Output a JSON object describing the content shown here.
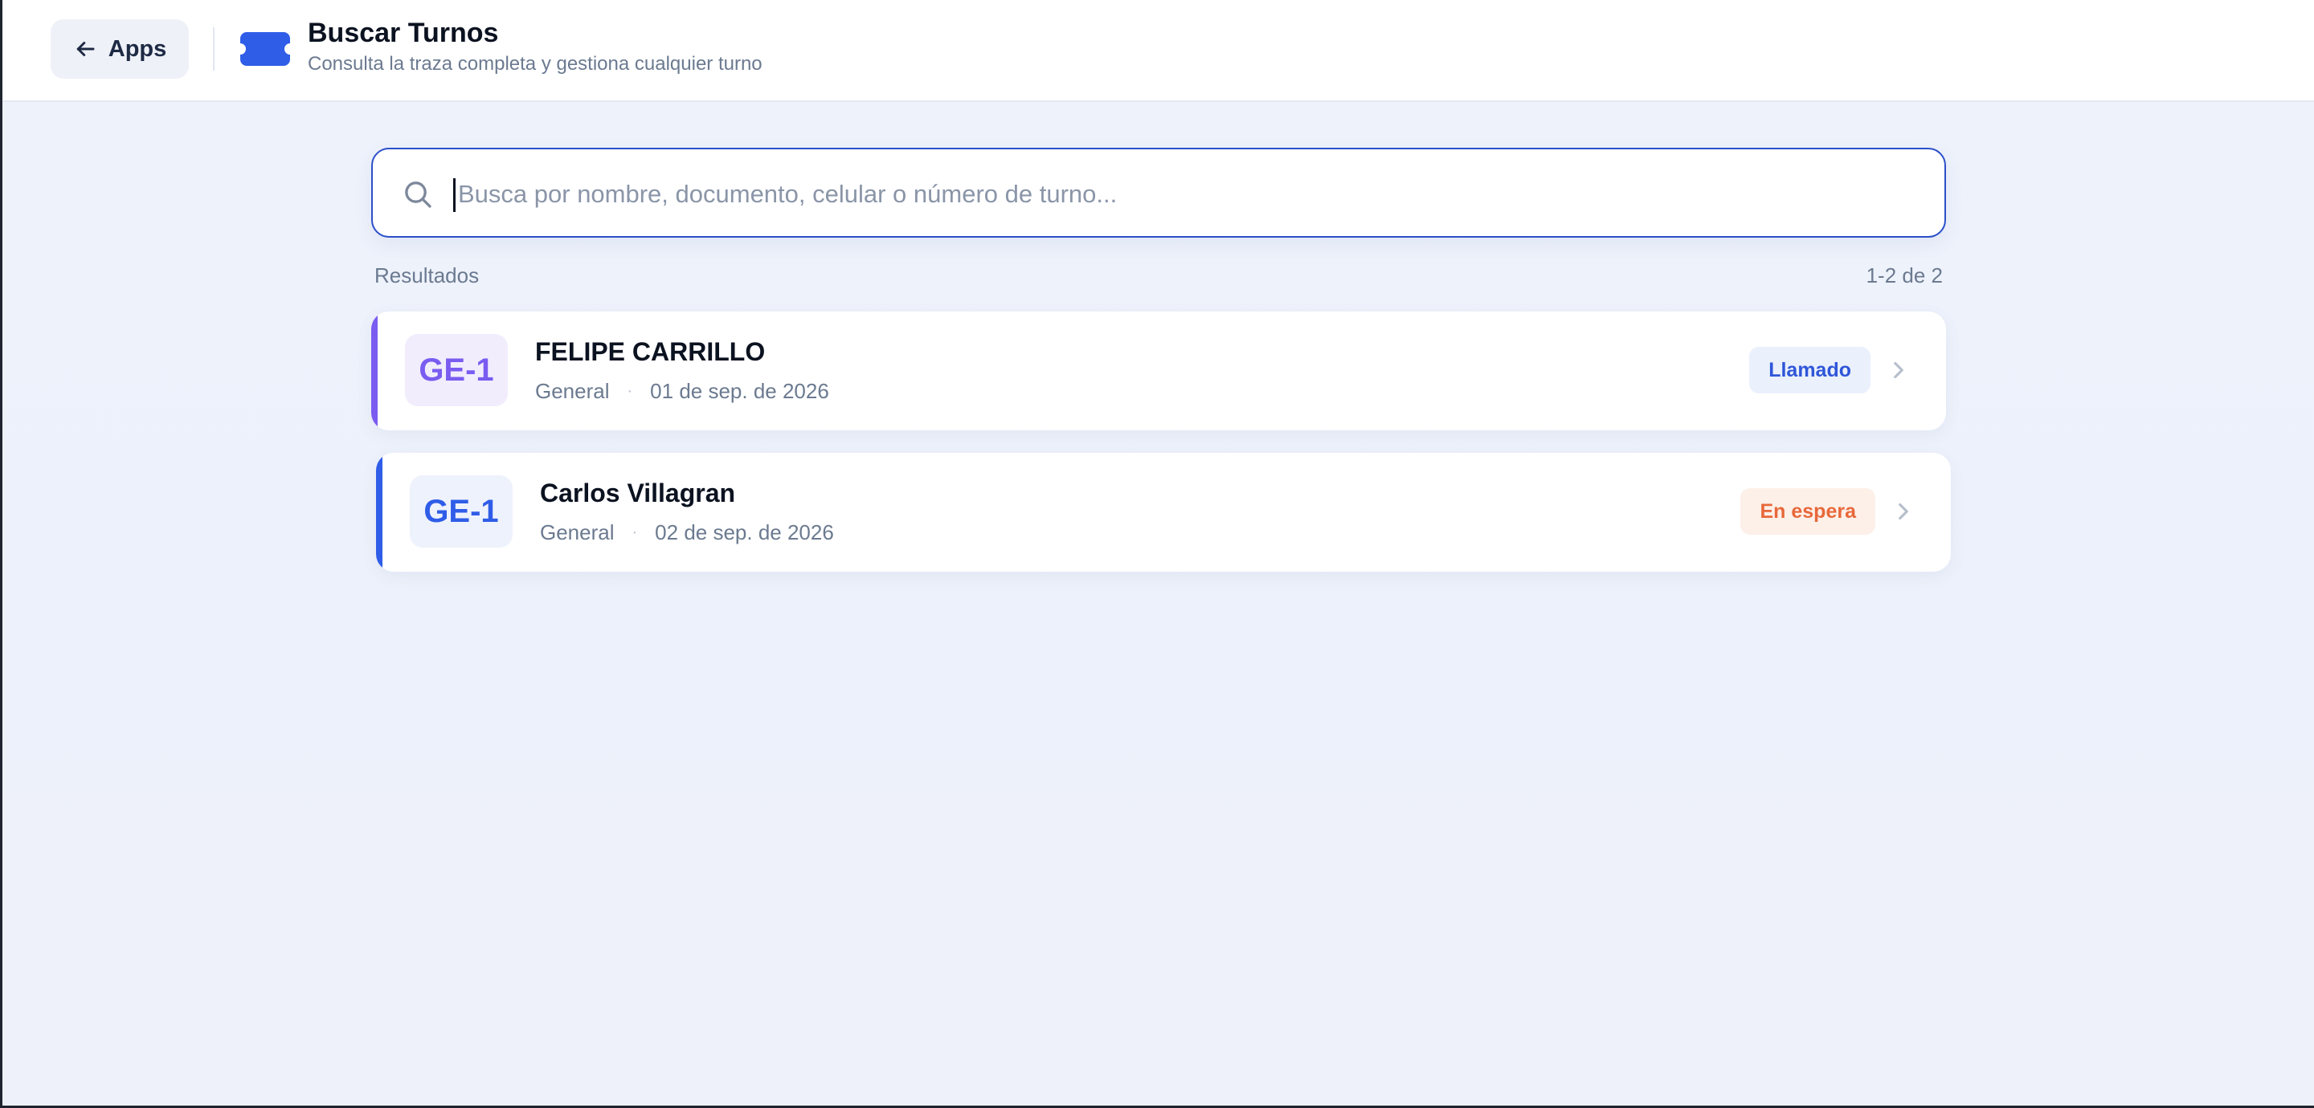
{
  "header": {
    "back_label": "Apps",
    "title": "Buscar Turnos",
    "subtitle": "Consulta la traza completa y gestiona cualquier turno",
    "icon": "ticket-icon",
    "accent_color": "#2f5de8"
  },
  "search": {
    "placeholder": "Busca por nombre, documento, celular o número de turno...",
    "value": ""
  },
  "results": {
    "label": "Resultados",
    "count": "1-2 de 2"
  },
  "cards": [
    {
      "code": "GE-1",
      "name": "FELIPE CARRILLO",
      "service": "General",
      "date": "01 de sep. de 2026",
      "status": "Llamado",
      "accent_color": "#7a5cf0",
      "code_color": "#7a5cf0",
      "code_bg": "#f1edfd",
      "status_color": "#2f56d8",
      "status_bg": "#eaf0fc"
    },
    {
      "code": "GE-1",
      "name": "Carlos Villagran",
      "service": "General",
      "date": "02 de sep. de 2026",
      "status": "En espera",
      "accent_color": "#2f5de8",
      "code_color": "#2f5de8",
      "code_bg": "#eef2fc",
      "status_color": "#e8683a",
      "status_bg": "#fdf0e9"
    }
  ]
}
